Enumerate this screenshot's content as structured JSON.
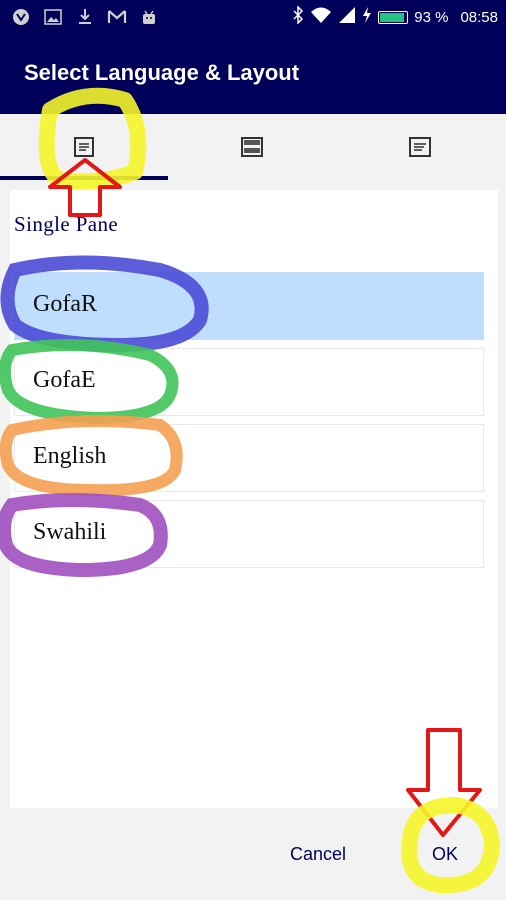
{
  "status_bar": {
    "icons_left": [
      "app-icon",
      "image-icon",
      "download-icon",
      "gmail-icon",
      "android-icon"
    ],
    "icons_right": [
      "bluetooth-icon",
      "wifi-icon",
      "signal-icon",
      "charging-icon",
      "battery-icon"
    ],
    "battery_percent": "93 %",
    "battery_level": 0.93,
    "time": "08:58"
  },
  "app_bar": {
    "title": "Select Language & Layout"
  },
  "tabs": [
    {
      "name": "single-pane-layout",
      "active": true,
      "icon": "single-pane-icon"
    },
    {
      "name": "split-pane-layout",
      "active": false,
      "icon": "split-pane-icon"
    },
    {
      "name": "text-layout",
      "active": false,
      "icon": "text-layout-icon"
    }
  ],
  "section": {
    "title": "Single Pane"
  },
  "languages": [
    {
      "label": "GofaR",
      "selected": true
    },
    {
      "label": "GofaE",
      "selected": false
    },
    {
      "label": "English",
      "selected": false
    },
    {
      "label": "Swahili",
      "selected": false
    }
  ],
  "footer": {
    "cancel_label": "Cancel",
    "ok_label": "OK"
  },
  "colors": {
    "bar": "#00005b",
    "selected": "#bfdefd",
    "annotation_yellow": "#f5f52a",
    "annotation_red": "#e51616",
    "annotation_blue": "#4b4bd6",
    "annotation_green": "#40c45a",
    "annotation_orange": "#f5a052",
    "annotation_purple": "#a050c0"
  }
}
